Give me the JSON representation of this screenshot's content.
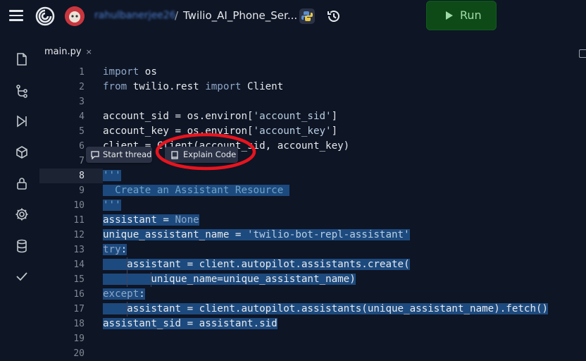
{
  "header": {
    "username": "rahulbanerjee26",
    "separator": "/",
    "repo_name": "Twilio_AI_Phone_Ser...",
    "run_label": "Run",
    "run_color": "#0e4a17"
  },
  "sidebar": {
    "items": [
      {
        "icon": "file-icon"
      },
      {
        "icon": "git-branch-icon"
      },
      {
        "icon": "debugger-icon"
      },
      {
        "icon": "package-icon"
      },
      {
        "icon": "lock-icon"
      },
      {
        "icon": "gear-icon"
      },
      {
        "icon": "database-icon"
      },
      {
        "icon": "checkmark-icon"
      }
    ]
  },
  "editor": {
    "tab_label": "main.py",
    "tab_close": "×",
    "current_line": 8,
    "line_numbers": [
      "1",
      "2",
      "3",
      "4",
      "5",
      "6",
      "7",
      "8",
      "9",
      "10",
      "11",
      "12",
      "13",
      "14",
      "15",
      "16",
      "17",
      "18",
      "19",
      "20"
    ]
  },
  "context_actions": {
    "start_thread": "Start thread",
    "explain_code": "Explain Code"
  },
  "colors": {
    "background": "#0e1525",
    "selection": "#1d4a7e",
    "annotation": "#e8141e"
  }
}
